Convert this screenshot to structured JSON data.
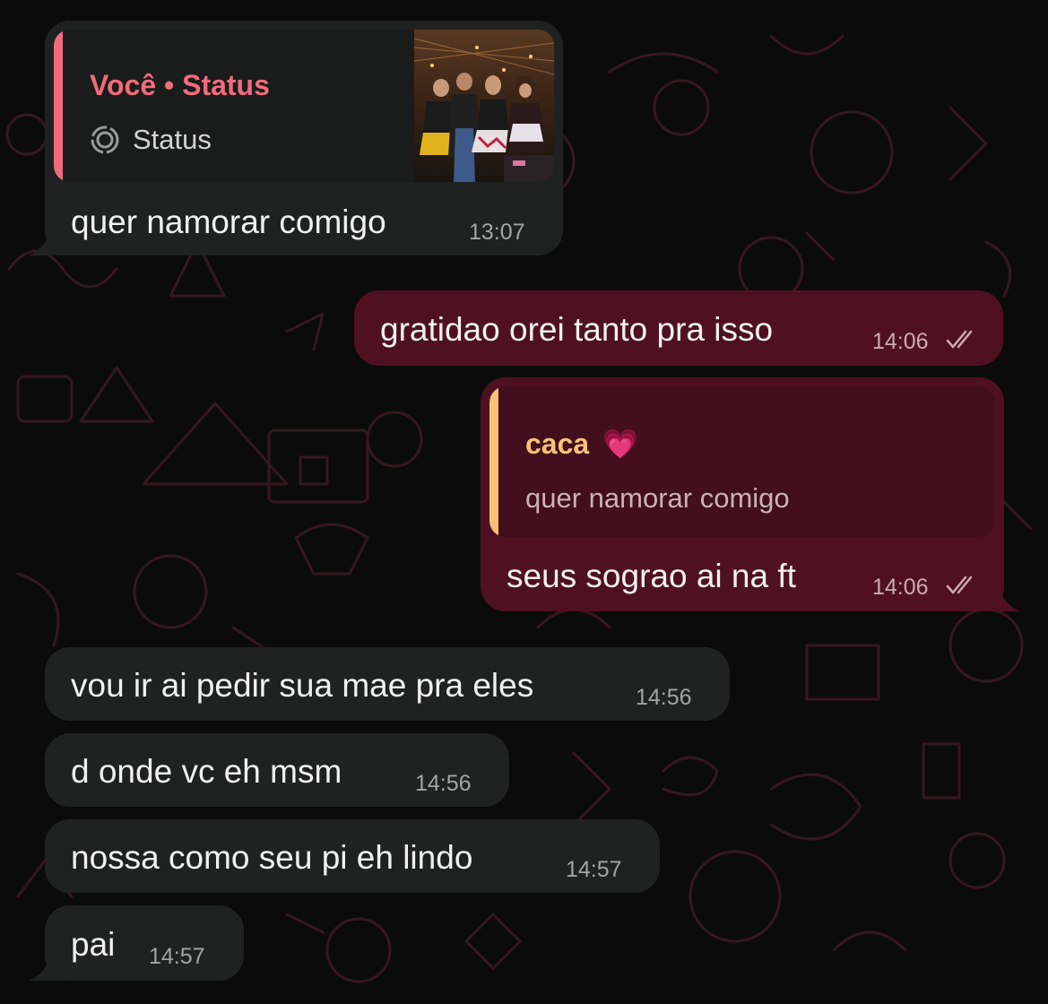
{
  "messages": [
    {
      "id": "m1",
      "direction": "incoming",
      "text": "quer namorar comigo",
      "time": "13:07",
      "reply": {
        "title": "Você • Status",
        "subtitle": "Status",
        "icon": "status-icon",
        "has_thumbnail": true
      }
    },
    {
      "id": "m2",
      "direction": "outgoing",
      "text": "gratidao orei tanto pra isso",
      "time": "14:06",
      "read": true
    },
    {
      "id": "m3",
      "direction": "outgoing",
      "text": "seus sograo ai na ft",
      "time": "14:06",
      "read": true,
      "reply": {
        "title": "caca",
        "title_emoji": "💗",
        "subtitle": "quer namorar comigo"
      }
    },
    {
      "id": "m4",
      "direction": "incoming",
      "text": "vou ir ai pedir sua mae pra eles",
      "time": "14:56"
    },
    {
      "id": "m5",
      "direction": "incoming",
      "text": "d onde vc eh msm",
      "time": "14:56"
    },
    {
      "id": "m6",
      "direction": "incoming",
      "text": "nossa como seu pi eh lindo",
      "time": "14:57"
    },
    {
      "id": "m7",
      "direction": "incoming",
      "text": "pai",
      "time": "14:57"
    }
  ],
  "colors": {
    "background": "#0b0b0b",
    "incoming_bubble": "#202222",
    "outgoing_bubble": "#4f1122",
    "status_reply_accent": "#f26b7c",
    "caca_reply_accent": "#f6c373",
    "read_ticks": "#cfa9b2"
  }
}
